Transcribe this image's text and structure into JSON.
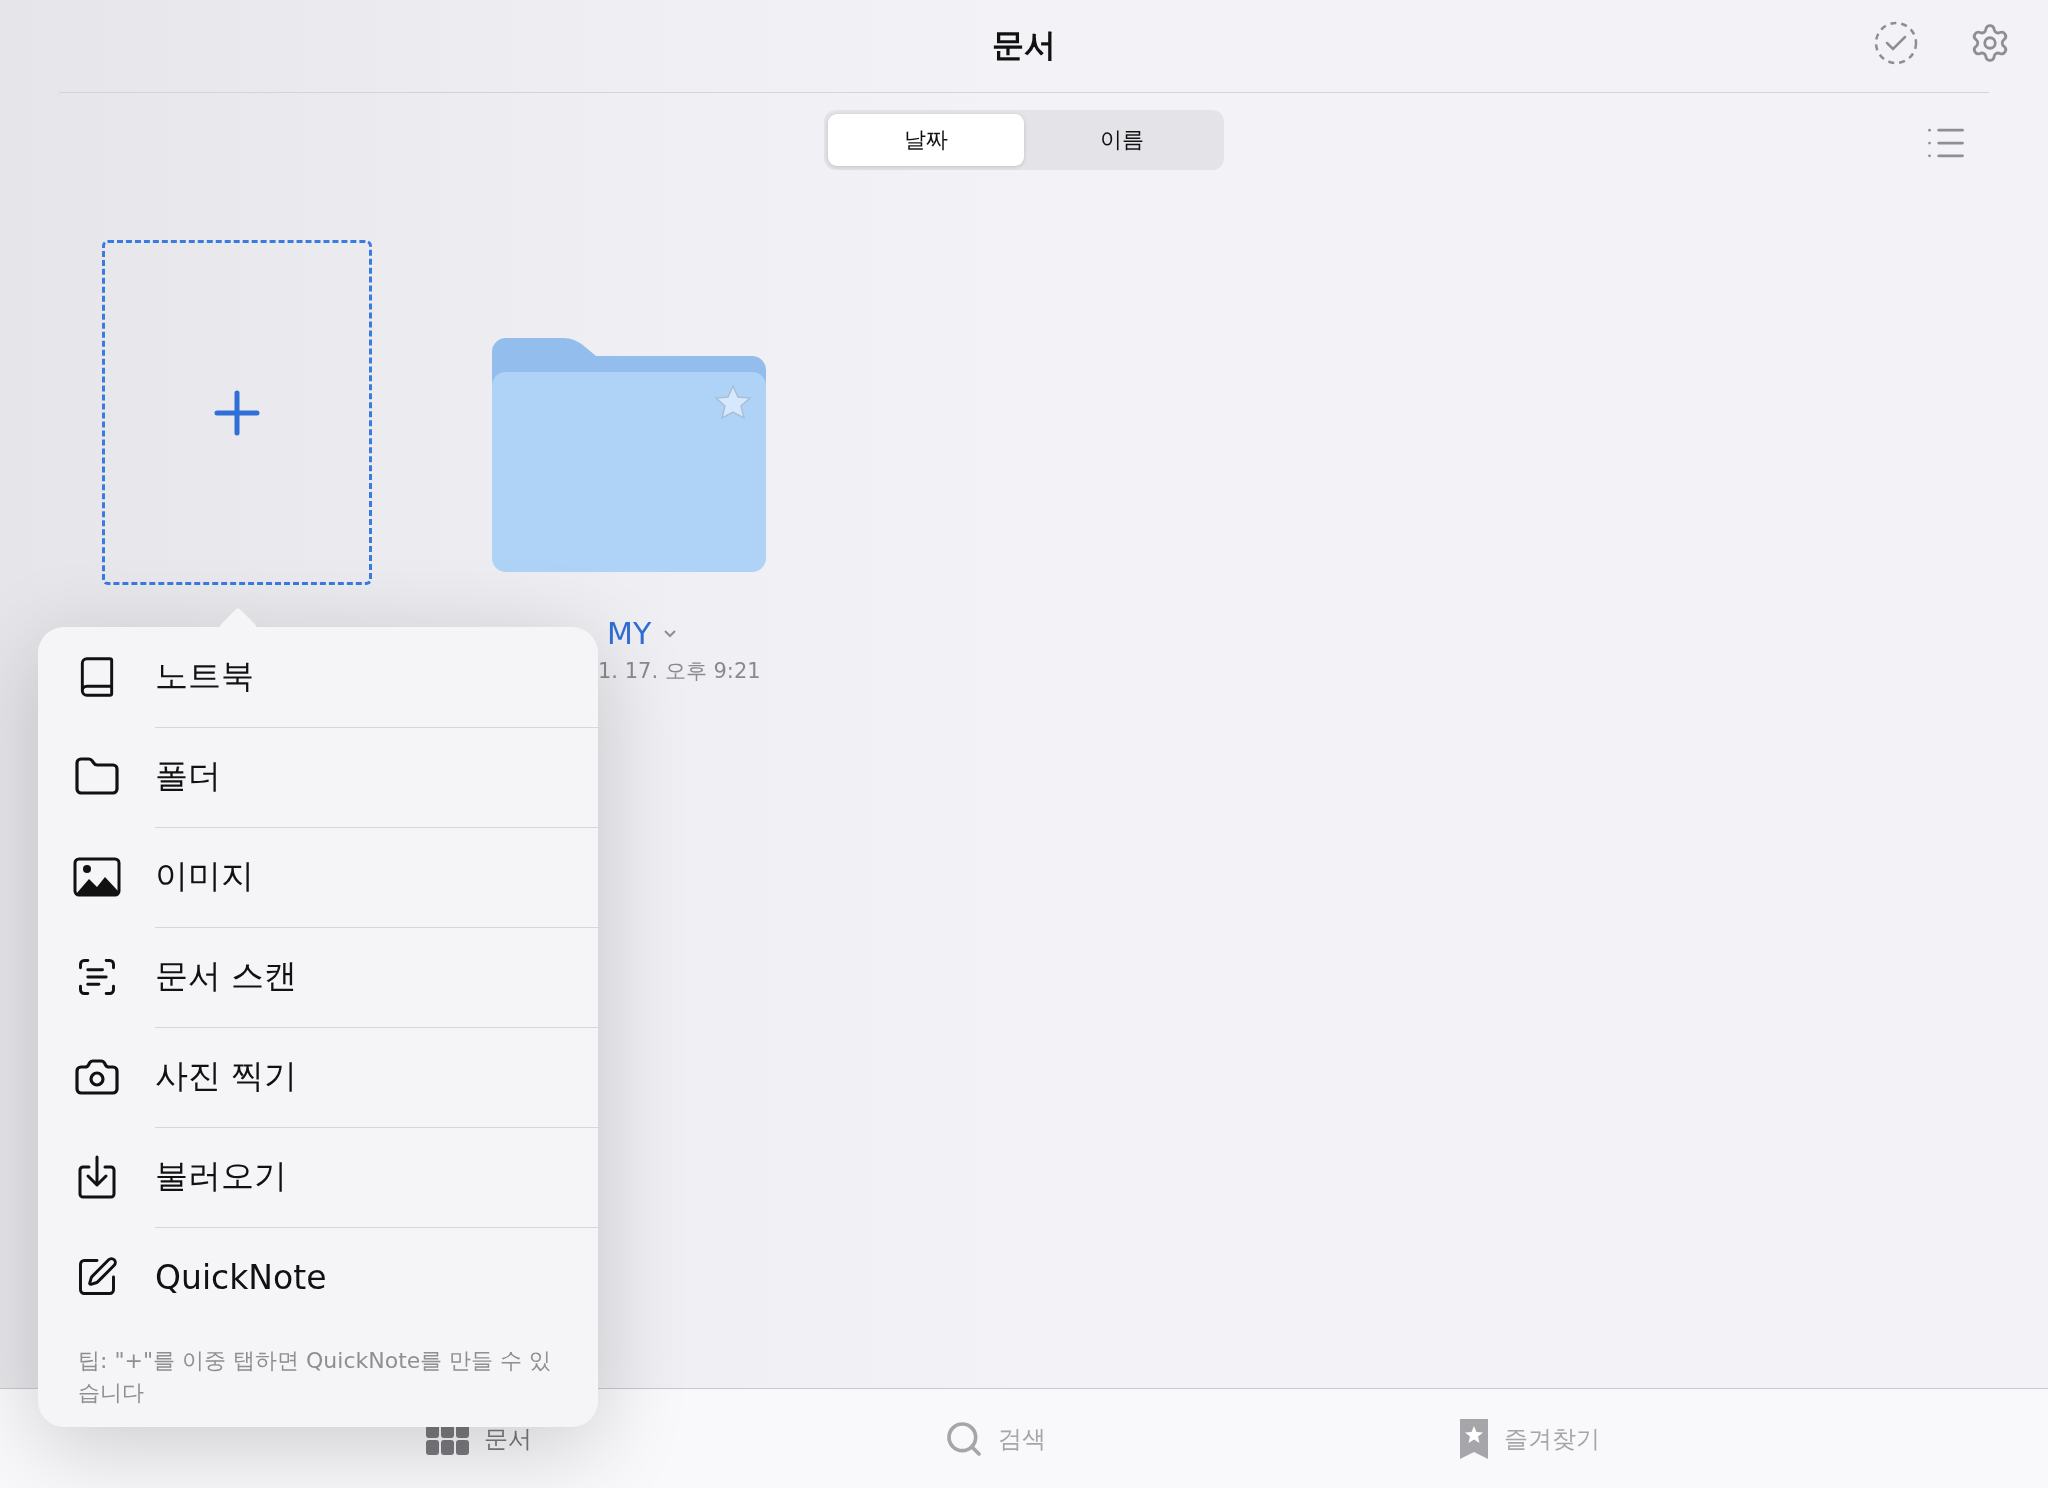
{
  "header": {
    "title": "문서"
  },
  "sort_tabs": [
    {
      "label": "날짜",
      "selected": true
    },
    {
      "label": "이름",
      "selected": false
    }
  ],
  "folder": {
    "name": "MY",
    "date": "1. 17. 오후 9:21"
  },
  "new_menu": {
    "items": [
      {
        "kind": "notebook",
        "label": "노트북"
      },
      {
        "kind": "folder",
        "label": "폴더"
      },
      {
        "kind": "image",
        "label": "이미지"
      },
      {
        "kind": "scan",
        "label": "문서 스캔"
      },
      {
        "kind": "camera",
        "label": "사진 찍기"
      },
      {
        "kind": "import",
        "label": "불러오기"
      },
      {
        "kind": "quicknote",
        "label": "QuickNote"
      }
    ],
    "tip": "팁: \"+\"를 이중 탭하면 QuickNote를 만들 수 있습니다"
  },
  "tab_bar": [
    {
      "kind": "documents",
      "label": "문서",
      "selected": true
    },
    {
      "kind": "search",
      "label": "검색",
      "selected": false
    },
    {
      "kind": "favorites",
      "label": "즐겨찾기",
      "selected": false
    }
  ]
}
